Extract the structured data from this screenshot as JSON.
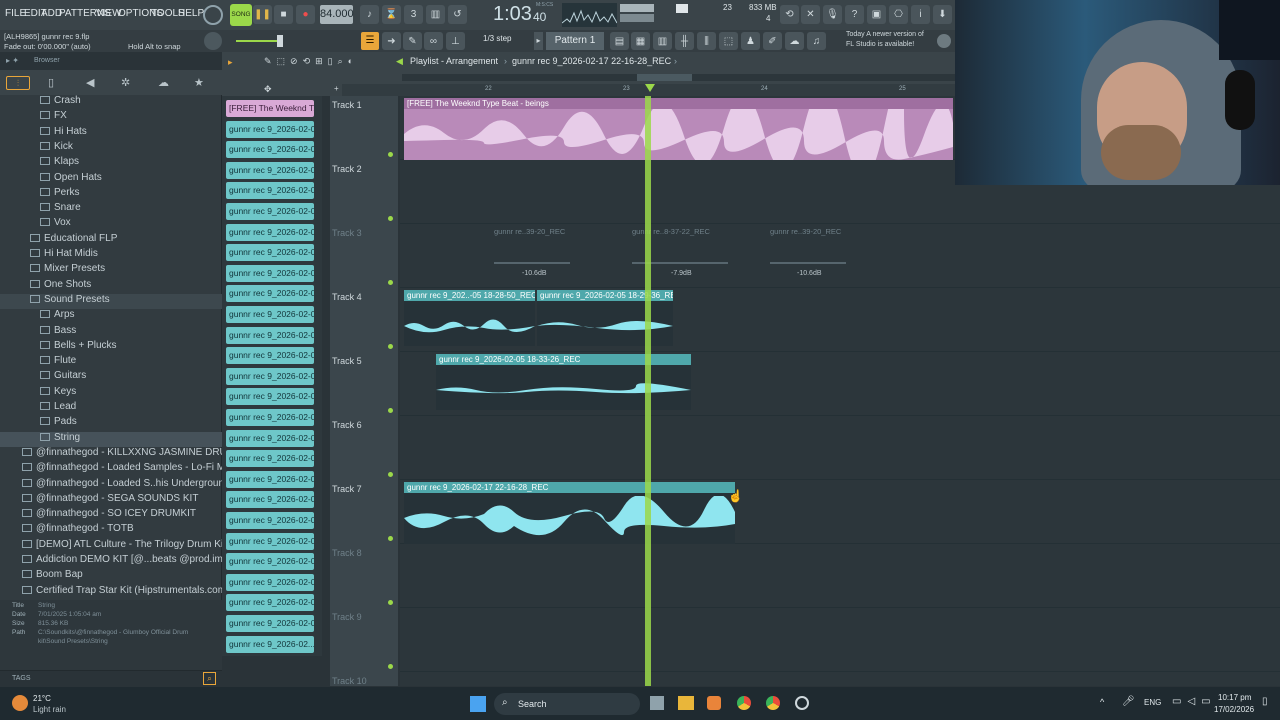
{
  "menu": [
    "FILE",
    "EDIT",
    "ADD",
    "PATTERNS",
    "VIEW",
    "OPTIONS",
    "TOOLS",
    "HELP"
  ],
  "transport": {
    "mode": "SONG",
    "tempo": "84.000",
    "time": "1:03",
    "time_small": "40",
    "msc": "M:S:CS",
    "cpu": "23",
    "mem": "833 MB",
    "voices": "4"
  },
  "hint": {
    "project": "[ALH9865] gunnr rec 9.flp",
    "fadeout": "Fade out: 0'00.000\" (auto)",
    "snap_hint": "Hold Alt to snap"
  },
  "toolbar2": {
    "step": "1/3 step",
    "pattern": "Pattern 1",
    "news_line1": "Today  A newer version of",
    "news_line2": "FL Studio is available!"
  },
  "browser": {
    "title": "Browser",
    "items": [
      {
        "label": "Crash",
        "indent": 3
      },
      {
        "label": "FX",
        "indent": 3
      },
      {
        "label": "Hi Hats",
        "indent": 3
      },
      {
        "label": "Kick",
        "indent": 3
      },
      {
        "label": "Klaps",
        "indent": 3
      },
      {
        "label": "Open Hats",
        "indent": 3
      },
      {
        "label": "Perks",
        "indent": 3
      },
      {
        "label": "Snare",
        "indent": 3
      },
      {
        "label": "Vox",
        "indent": 3
      },
      {
        "label": "Educational FLP",
        "indent": 2
      },
      {
        "label": "Hi Hat Midis",
        "indent": 2
      },
      {
        "label": "Mixer Presets",
        "indent": 2
      },
      {
        "label": "One Shots",
        "indent": 2
      },
      {
        "label": "Sound Presets",
        "indent": 2,
        "selected": true
      },
      {
        "label": "Arps",
        "indent": 3
      },
      {
        "label": "Bass",
        "indent": 3
      },
      {
        "label": "Bells + Plucks",
        "indent": 3
      },
      {
        "label": "Flute",
        "indent": 3
      },
      {
        "label": "Guitars",
        "indent": 3
      },
      {
        "label": "Keys",
        "indent": 3
      },
      {
        "label": "Lead",
        "indent": 3
      },
      {
        "label": "Pads",
        "indent": 3
      },
      {
        "label": "String",
        "indent": 3,
        "active": true
      },
      {
        "label": "@finnathegod - KILLXXNG JASMINE DRUMKIT",
        "indent": 1
      },
      {
        "label": "@finnathegod - Loaded Samples - Lo-Fi Memphis",
        "indent": 1
      },
      {
        "label": "@finnathegod - Loaded S..his Underground Vol. 2",
        "indent": 1
      },
      {
        "label": "@finnathegod - SEGA SOUNDS KIT",
        "indent": 1
      },
      {
        "label": "@finnathegod - SO ICEY DRUMKIT",
        "indent": 1
      },
      {
        "label": "@finnathegod - TOTB",
        "indent": 1
      },
      {
        "label": "[DEMO] ATL Culture - The Trilogy Drum Kit",
        "indent": 1
      },
      {
        "label": "Addiction DEMO KIT [@...beats @prod.immortal]",
        "indent": 1
      },
      {
        "label": "Boom Bap",
        "indent": 1
      },
      {
        "label": "Certified Trap Star Kit (Hipstrumentals.com)",
        "indent": 1
      }
    ],
    "info": {
      "title_label": "Title",
      "title": "String",
      "date_label": "Date",
      "date": "7/01/2025 1:05:04 am",
      "size_label": "Size",
      "size": "815.36 KB",
      "path_label": "Path",
      "path1": "C:\\Soundkits\\@finnathegod - Glumboy Official Drum",
      "path2": "kit\\Sound Presets\\String"
    },
    "tags": "TAGS"
  },
  "playlist": {
    "title": "Playlist - Arrangement",
    "pattern_name": "gunnr rec 9_2026-02-17 22-16-28_REC",
    "ruler": [
      "22",
      "23",
      "24",
      "25"
    ]
  },
  "channels": [
    "[FREE] The Weeknd T...",
    "gunnr rec 9_2026-02-03...",
    "gunnr rec 9_2026-02-03...",
    "gunnr rec 9_2026-02-03...",
    "gunnr rec 9_2026-02-03...",
    "gunnr rec 9_2026-02-03...",
    "gunnr rec 9_2026-02-03...",
    "gunnr rec 9_2026-02-03...",
    "gunnr rec 9_2026-02-03...",
    "gunnr rec 9_2026-02-03...",
    "gunnr rec 9_2026-02-03...",
    "gunnr rec 9_2026-02-03...",
    "gunnr rec 9_2026-02-03...",
    "gunnr rec 9_2026-02-03...",
    "gunnr rec 9_2026-02-03...",
    "gunnr rec 9_2026-02-03...",
    "gunnr rec 9_2026-02-03...",
    "gunnr rec 9_2026-02-03...",
    "gunnr rec 9_2026-02-05...",
    "gunnr rec 9_2026-02-05...",
    "gunnr rec 9_2026-02-05...",
    "gunnr rec 9_2026-02-05...",
    "gunnr rec 9_2026-02-05...",
    "gunnr rec 9_2026-02-05...",
    "gunnr rec 9_2026-02-05...",
    "gunnr rec 9_2026-02-05...",
    "gunnr rec 9_2026-02..."
  ],
  "tracks": [
    "Track 1",
    "Track 2",
    "Track 3",
    "Track 4",
    "Track 5",
    "Track 6",
    "Track 7",
    "Track 8",
    "Track 9",
    "Track 10"
  ],
  "clips": {
    "t1": "[FREE] The Weeknd Type Beat - beings",
    "t3a": "gunnr re..39-20_REC",
    "t3b": "gunnr re..8-37-22_REC",
    "t3c": "gunnr re..39-20_REC",
    "t3a_db": "-10.6dB",
    "t3b_db": "-7.9dB",
    "t3c_db": "-10.6dB",
    "t4a": "gunnr rec 9_202..-05 18-28-50_REC",
    "t4b": "gunnr rec 9_2026-02-05 18-29-36_REC",
    "t5": "gunnr rec 9_2026-02-05 18-33-26_REC",
    "t7": "gunnr rec 9_2026-02-17 22-16-28_REC"
  },
  "taskbar": {
    "weather_temp": "21°C",
    "weather_desc": "Light rain",
    "search": "Search",
    "lang": "ENG",
    "time": "10:17 pm",
    "date": "17/02/2026"
  },
  "colors": {
    "accent_clip": "#6ec7c9",
    "pink_clip": "#d9a9d6",
    "playhead": "#9bd84a"
  }
}
